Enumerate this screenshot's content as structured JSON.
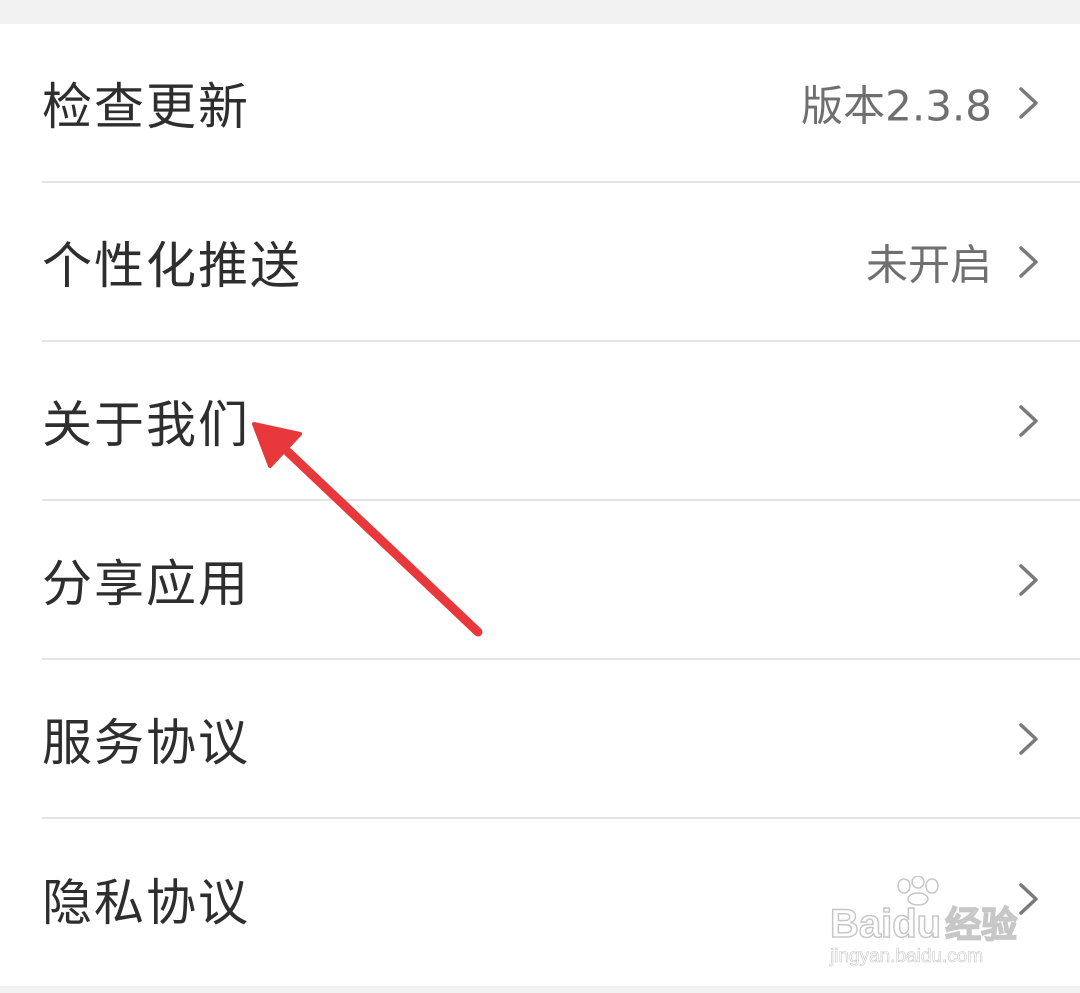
{
  "settings": {
    "items": [
      {
        "label": "检查更新",
        "value": "版本2.3.8"
      },
      {
        "label": "个性化推送",
        "value": "未开启"
      },
      {
        "label": "关于我们",
        "value": ""
      },
      {
        "label": "分享应用",
        "value": ""
      },
      {
        "label": "服务协议",
        "value": ""
      },
      {
        "label": "隐私协议",
        "value": ""
      }
    ]
  },
  "annotation": {
    "arrow_color": "#e8383b"
  },
  "watermark": {
    "brand": "Bai",
    "brand_end": "du",
    "brand_cn": "经验",
    "url": "jingyan.baidu.com"
  },
  "colors": {
    "background": "#f2f2f2",
    "row_background": "#ffffff",
    "label_text": "#2e2e2e",
    "value_text": "#6f6f6f",
    "divider": "#e4e4e4",
    "chevron": "#7a7a7a"
  },
  "icons": {
    "row_action": "chevron-right-icon",
    "watermark_logo": "paw-icon"
  }
}
